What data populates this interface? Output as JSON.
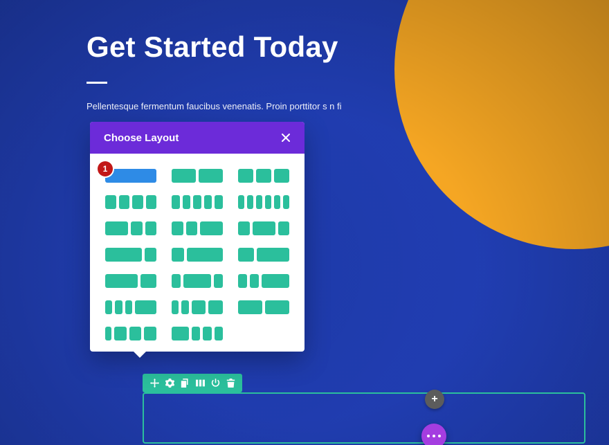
{
  "hero": {
    "title": "Get Started Today",
    "lead": "Pellentesque fermentum faucibus venenatis. Proin porttitor s\nn\nfi"
  },
  "popover": {
    "title": "Choose Layout",
    "badge": "1",
    "layouts": [
      {
        "cols": [
          1
        ],
        "selected": true
      },
      {
        "cols": [
          1,
          1
        ]
      },
      {
        "cols": [
          1,
          1,
          1
        ]
      },
      {
        "cols": [
          1,
          1,
          1,
          1
        ]
      },
      {
        "cols": [
          1,
          1,
          1,
          1,
          1
        ]
      },
      {
        "cols": [
          1,
          1,
          1,
          1,
          1,
          1
        ]
      },
      {
        "cols": [
          2,
          1,
          1
        ]
      },
      {
        "cols": [
          1,
          1,
          2
        ]
      },
      {
        "cols": [
          1,
          2,
          1
        ]
      },
      {
        "cols": [
          3,
          1
        ]
      },
      {
        "cols": [
          1,
          3
        ]
      },
      {
        "cols": [
          1,
          2
        ]
      },
      {
        "cols": [
          2,
          1
        ]
      },
      {
        "cols": [
          1,
          3,
          1
        ]
      },
      {
        "cols": [
          1,
          1,
          3
        ]
      },
      {
        "cols": [
          1,
          1,
          1,
          3
        ]
      },
      {
        "cols": [
          1,
          1,
          2,
          2
        ]
      },
      {
        "cols": [
          1,
          1
        ]
      },
      {
        "cols": [
          1,
          2,
          2,
          2
        ]
      },
      {
        "cols": [
          2,
          1,
          1,
          1
        ]
      }
    ]
  },
  "toolbar": {
    "icons": [
      "move",
      "gear",
      "duplicate",
      "columns",
      "power",
      "trash"
    ]
  },
  "buttons": {
    "plus": "+",
    "more": "⋯"
  },
  "colors": {
    "accent_teal": "#2bbf9c",
    "accent_purple": "#6c2bd9",
    "accent_blue": "#2e8be6",
    "badge_red": "#c21818",
    "sun_orange": "#f5a623",
    "fab_purple": "#a43de0"
  }
}
